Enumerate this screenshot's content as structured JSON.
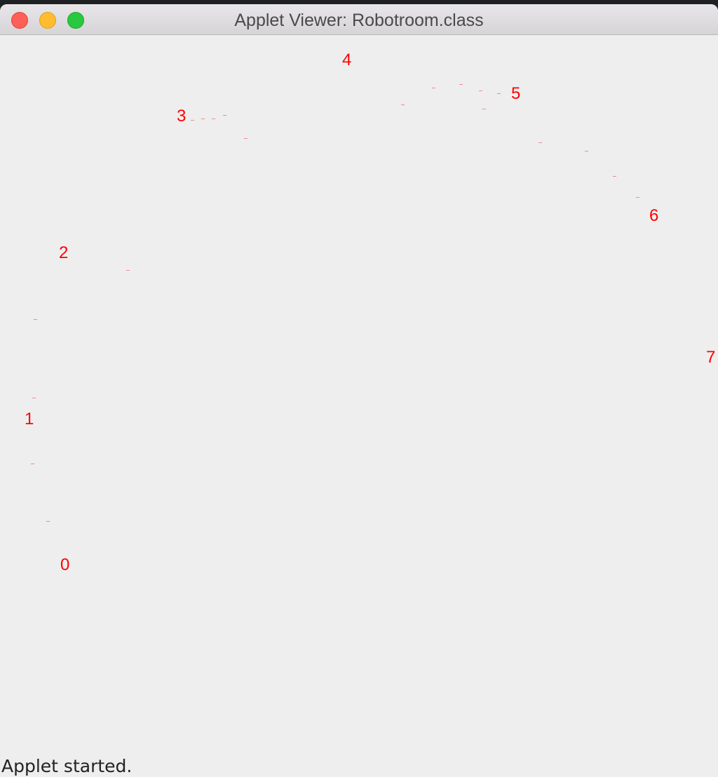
{
  "window": {
    "title": "Applet Viewer: Robotroom.class"
  },
  "canvas": {
    "node_labels": [
      "0",
      "1",
      "2",
      "3",
      "4",
      "5",
      "6",
      "7"
    ],
    "label_color": "#ff0000",
    "path_color": "#f08a8a"
  },
  "status_bar": {
    "text": "Applet started."
  }
}
